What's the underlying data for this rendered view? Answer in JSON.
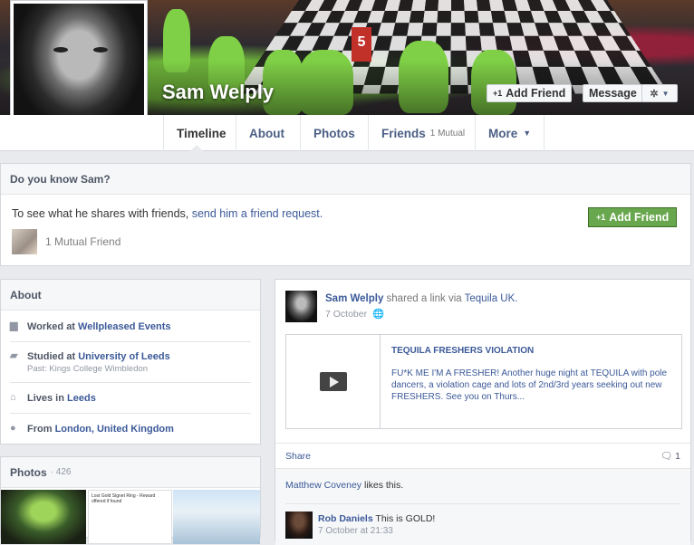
{
  "profile": {
    "name": "Sam Welply",
    "cover_marker": "5"
  },
  "cover_actions": {
    "add_friend_plus": "+1",
    "add_friend_label": "Add Friend",
    "message_label": "Message",
    "settings_icon": "gear-icon"
  },
  "tabs": [
    {
      "label": "Timeline",
      "active": true
    },
    {
      "label": "About"
    },
    {
      "label": "Photos"
    },
    {
      "label": "Friends",
      "sub": "1 Mutual"
    },
    {
      "label": "More"
    }
  ],
  "know": {
    "heading": "Do you know Sam?",
    "text_prefix": "To see what he shares with friends, ",
    "text_link": "send him a friend request.",
    "mutual_label": "1 Mutual Friend",
    "button_plus": "+1",
    "button_label": "Add Friend"
  },
  "about": {
    "heading": "About",
    "items": [
      {
        "prefix": "Worked at ",
        "value": "Wellpleased Events",
        "sub": ""
      },
      {
        "prefix": "Studied at ",
        "value": "University of Leeds",
        "sub": "Past: Kings College Wimbledon"
      },
      {
        "prefix": "Lives in ",
        "value": "Leeds",
        "sub": ""
      },
      {
        "prefix": "From ",
        "value": "London, United Kingdom",
        "sub": ""
      }
    ]
  },
  "photos": {
    "heading": "Photos",
    "count": "· 426",
    "thumb2_caption": "Lost Gold Signet Ring - Reward offered if found"
  },
  "post": {
    "author": "Sam Welply",
    "action": " shared a link via ",
    "via": "Tequila UK.",
    "date": "7 October",
    "share_title": "TEQUILA FRESHERS VIOLATION",
    "share_desc": "FU*K ME I'M A FRESHER! Another huge night at TEQUILA with pole dancers, a violation cage and lots of 2nd/3rd years seeking out new FRESHERS. See you on Thurs...",
    "share_action": "Share",
    "comment_count": "1",
    "likes_name": "Matthew Coveney",
    "likes_suffix": " likes this.",
    "comment_author": "Rob Daniels",
    "comment_text": " This is GOLD!",
    "comment_date": "7 October at 21:33"
  },
  "colors": {
    "brand_blue": "#3b5998",
    "green_button": "#69a74e",
    "page_bg": "#e9eaed"
  }
}
